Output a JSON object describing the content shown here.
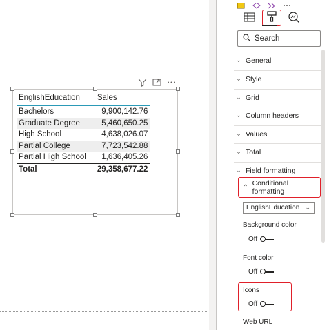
{
  "table": {
    "headers": [
      "EnglishEducation",
      "Sales"
    ],
    "rows": [
      {
        "education": "Bachelors",
        "sales": "9,900,142.76"
      },
      {
        "education": "Graduate Degree",
        "sales": "5,460,650.25"
      },
      {
        "education": "High School",
        "sales": "4,638,026.07"
      },
      {
        "education": "Partial College",
        "sales": "7,723,542.88"
      },
      {
        "education": "Partial High School",
        "sales": "1,636,405.26"
      }
    ],
    "total_label": "Total",
    "total_value": "29,358,677.22"
  },
  "visual_header": {
    "icons": [
      "filter-icon",
      "focus-mode-icon",
      "more-options-icon"
    ]
  },
  "pane": {
    "tabs": [
      {
        "name": "fields-tab",
        "icon": "table-grid-icon"
      },
      {
        "name": "format-tab",
        "icon": "paint-roller-icon",
        "active": true
      },
      {
        "name": "analytics-tab",
        "icon": "magnifier-chart-icon"
      }
    ],
    "search_placeholder": "Search",
    "sections": [
      "General",
      "Style",
      "Grid",
      "Column headers",
      "Values",
      "Total",
      "Field formatting"
    ],
    "conditional_formatting": "Conditional formatting",
    "field_select": "EnglishEducation",
    "background_color": {
      "label": "Background color",
      "state": "Off"
    },
    "font_color": {
      "label": "Font color",
      "state": "Off"
    },
    "icons": {
      "label": "Icons",
      "state": "Off"
    },
    "web_url": "Web URL"
  },
  "colors": {
    "highlight": "#e0202a",
    "header_rule": "#2b9ab7"
  }
}
